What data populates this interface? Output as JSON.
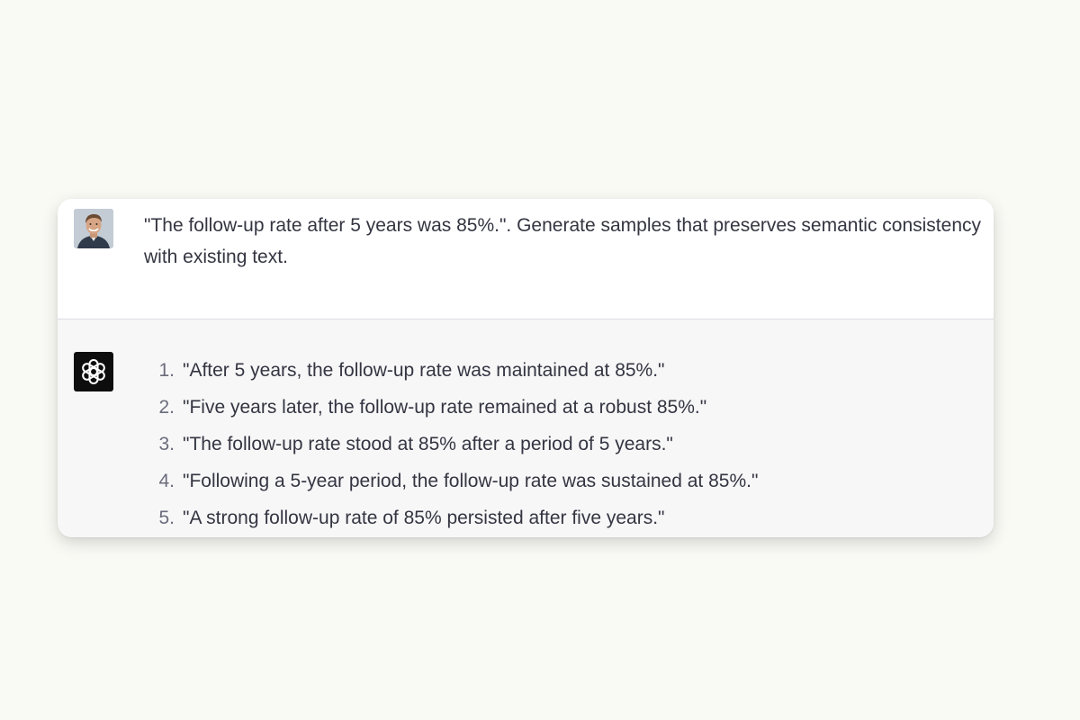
{
  "conversation": {
    "user": {
      "avatar_icon": "user-photo-avatar",
      "message": "\"The follow-up rate after 5 years was 85%.\". Generate samples that preserves semantic consistency with existing text."
    },
    "assistant": {
      "avatar_icon": "openai-logo-icon",
      "items": [
        {
          "number": "1.",
          "text": "\"After 5 years, the follow-up rate was maintained at 85%.\""
        },
        {
          "number": "2.",
          "text": "\"Five years later, the follow-up rate remained at a robust 85%.\""
        },
        {
          "number": "3.",
          "text": "\"The follow-up rate stood at 85% after a period of 5 years.\""
        },
        {
          "number": "4.",
          "text": "\"Following a 5-year period, the follow-up rate was sustained at 85%.\""
        },
        {
          "number": "5.",
          "text": "\"A strong follow-up rate of 85% persisted after five years.\""
        }
      ]
    }
  },
  "colors": {
    "page_background": "#fafaf5",
    "assistant_background": "#f7f7f8",
    "text": "#343541",
    "bot_avatar": "#0d0d0d"
  }
}
